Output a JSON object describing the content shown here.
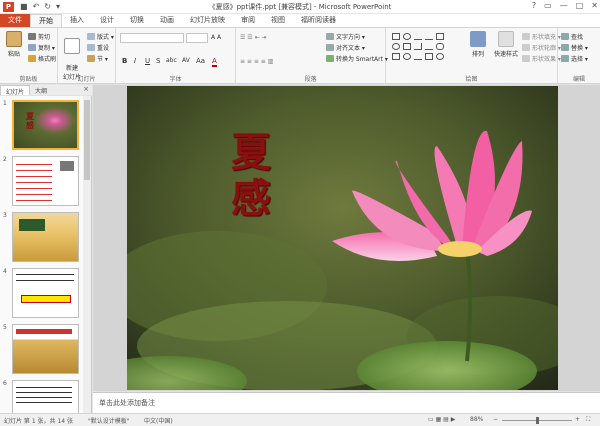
{
  "app": {
    "logo": "P",
    "title": "《夏感》ppt课件.ppt [兼容模式] - Microsoft PowerPoint",
    "qat_icons": [
      "save-icon",
      "undo-icon",
      "redo-icon",
      "customize-icon"
    ]
  },
  "window_controls": {
    "help": "?",
    "restore": "▭",
    "minimize": "—",
    "maximize": "□",
    "close": "✕"
  },
  "tabs": [
    "文件",
    "开始",
    "插入",
    "设计",
    "切换",
    "动画",
    "幻灯片放映",
    "审阅",
    "视图",
    "福昕阅读器"
  ],
  "ribbon": {
    "clipboard": {
      "paste": "粘贴",
      "cut": "剪切",
      "copy": "复制 ▾",
      "format_painter": "格式刷",
      "label": "剪贴板"
    },
    "slides": {
      "new_slide": "新建\n幻灯片",
      "layout": "版式 ▾",
      "reset": "重设",
      "section": "节 ▾",
      "label": "幻灯片"
    },
    "font": {
      "bold": "B",
      "italic": "I",
      "underline": "U",
      "strike": "S",
      "shadow": "abc",
      "spacing": "AV",
      "case": "Aa",
      "color": "A",
      "label": "字体"
    },
    "paragraph": {
      "text_direction": "文字方向 ▾",
      "align_text": "对齐文本 ▾",
      "smartart": "转换为 SmartArt ▾",
      "label": "段落"
    },
    "drawing": {
      "arrange": "排列",
      "quick_styles": "快速样式",
      "shape_fill": "形状填充 ▾",
      "shape_outline": "形状轮廓 ▾",
      "shape_effects": "形状效果 ▾",
      "label": "绘图"
    },
    "editing": {
      "find": "查找",
      "replace": "替换 ▾",
      "select": "选择 ▾",
      "label": "编辑"
    }
  },
  "pane": {
    "tab_slides": "幻灯片",
    "tab_outline": "大纲",
    "close": "×",
    "thumb_numbers": [
      "1",
      "2",
      "3",
      "4",
      "5",
      "6"
    ]
  },
  "slide": {
    "title_line1": "夏",
    "title_line2": "感"
  },
  "notes": {
    "placeholder": "单击此处添加备注"
  },
  "status": {
    "slide_info": "幻灯片 第 1 张，共 14 张",
    "theme": "\"默认设计模板\"",
    "language": "中文(中国)",
    "zoom": "88%"
  }
}
